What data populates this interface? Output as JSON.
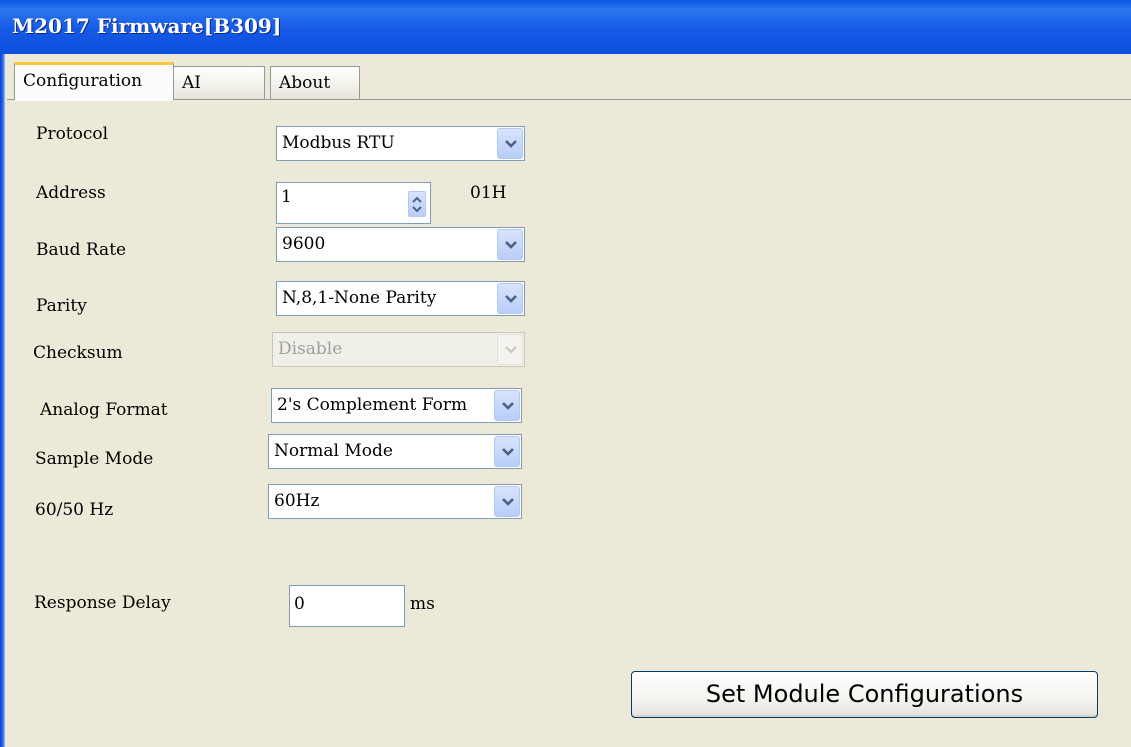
{
  "window": {
    "title": "M2017 Firmware[B309]"
  },
  "tabs": [
    {
      "label": "Configuration"
    },
    {
      "label": "AI"
    },
    {
      "label": "About"
    }
  ],
  "form": {
    "protocol": {
      "label": "Protocol",
      "value": "Modbus RTU"
    },
    "address": {
      "label": "Address",
      "value": "1",
      "hex": "01H"
    },
    "baud_rate": {
      "label": "Baud Rate",
      "value": "9600"
    },
    "parity": {
      "label": "Parity",
      "value": "N,8,1-None Parity"
    },
    "checksum": {
      "label": "Checksum",
      "value": "Disable",
      "enabled": false
    },
    "analog_format": {
      "label": "Analog Format",
      "value": "2's Complement Form"
    },
    "sample_mode": {
      "label": "Sample Mode",
      "value": "Normal Mode"
    },
    "frequency": {
      "label": "60/50 Hz",
      "value": "60Hz"
    },
    "response_delay": {
      "label": "Response Delay",
      "value": "0",
      "unit": "ms"
    }
  },
  "actions": {
    "set_label": "Set Module Configurations"
  },
  "colors": {
    "titlebar": "#0a58e0",
    "background": "#ece9d8",
    "active_tab_accent": "#ffc83c",
    "button_border": "#003c74"
  },
  "icons": [
    "chevron-down-icon",
    "spin-up-icon",
    "spin-down-icon"
  ]
}
